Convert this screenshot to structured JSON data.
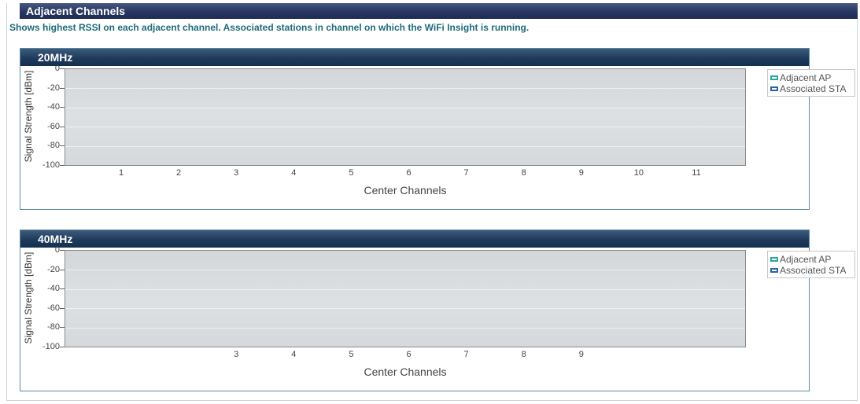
{
  "section": {
    "title": "Adjacent Channels",
    "description": "Shows highest RSSI on each adjacent channel. Associated stations in channel on which the WiFi Insight is running."
  },
  "colors": {
    "adjacent_ap": "#2aa89a",
    "associated_sta": "#2d62a8",
    "header": "#1f3b5c"
  },
  "legend": {
    "adjacent_ap": "Adjacent AP",
    "associated_sta": "Associated STA"
  },
  "chart_data": [
    {
      "type": "bar",
      "title": "20MHz",
      "xlabel": "Center Channels",
      "ylabel": "Signal Strength [dBm]",
      "categories": [
        "1",
        "2",
        "3",
        "4",
        "5",
        "6",
        "7",
        "8",
        "9",
        "10",
        "11"
      ],
      "yticks": [
        "0",
        "-20",
        "-40",
        "-60",
        "-80",
        "-100"
      ],
      "ylim": [
        -100,
        0
      ],
      "series": [
        {
          "name": "Adjacent AP",
          "values": []
        },
        {
          "name": "Associated STA",
          "values": []
        }
      ],
      "legend_position": "right"
    },
    {
      "type": "bar",
      "title": "40MHz",
      "xlabel": "Center Channels",
      "ylabel": "Signal Strength [dBm]",
      "categories": [
        "3",
        "4",
        "5",
        "6",
        "7",
        "8",
        "9"
      ],
      "yticks": [
        "0",
        "-20",
        "-40",
        "-60",
        "-80",
        "-100"
      ],
      "ylim": [
        -100,
        0
      ],
      "series": [
        {
          "name": "Adjacent AP",
          "values": []
        },
        {
          "name": "Associated STA",
          "values": []
        }
      ],
      "legend_position": "right"
    }
  ]
}
